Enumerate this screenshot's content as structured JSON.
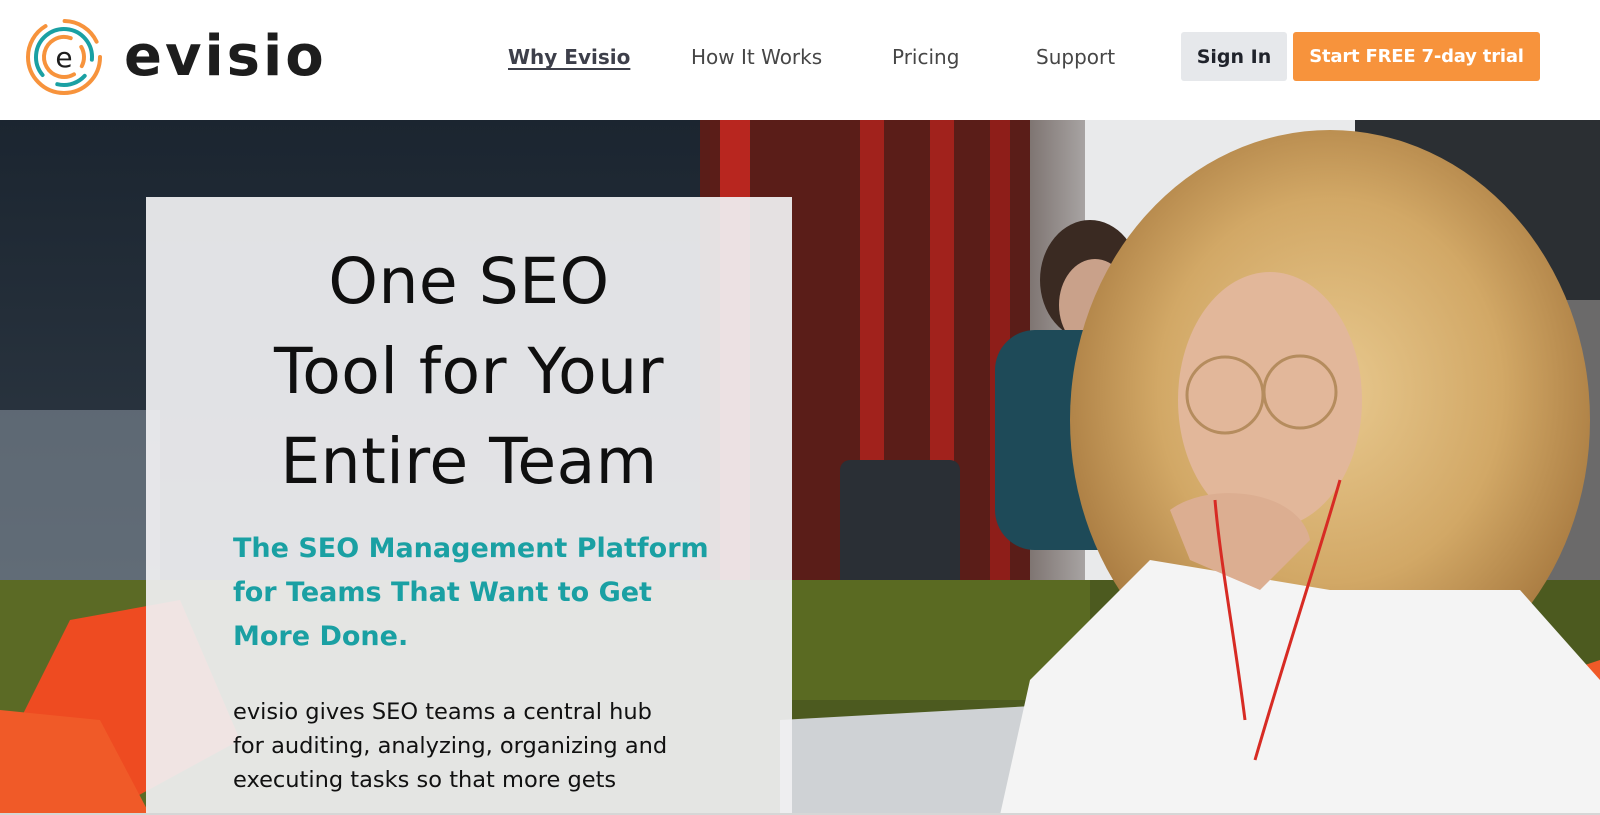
{
  "brand": {
    "name": "evisio",
    "logo_letter": "e",
    "colors": {
      "orange": "#f7933c",
      "teal": "#1aa0a3",
      "dark": "#1d1d1d"
    }
  },
  "nav": {
    "items": [
      {
        "label": "Why Evisio",
        "active": true
      },
      {
        "label": "How It Works",
        "active": false
      },
      {
        "label": "Pricing",
        "active": false
      },
      {
        "label": "Support",
        "active": false
      }
    ],
    "sign_in_label": "Sign In",
    "trial_label": "Start FREE 7-day trial"
  },
  "hero": {
    "headline_lines": [
      "One SEO",
      "Tool for Your",
      "Entire Team"
    ],
    "subhead_lines": [
      "The SEO Management Platform",
      "for Teams That Want to Get",
      "More Done."
    ],
    "body_lines": [
      "evisio gives SEO teams a central hub",
      "for auditing, analyzing, organizing and",
      "executing tasks so that more gets"
    ],
    "image_subject": "woman-with-laptop-photo"
  }
}
